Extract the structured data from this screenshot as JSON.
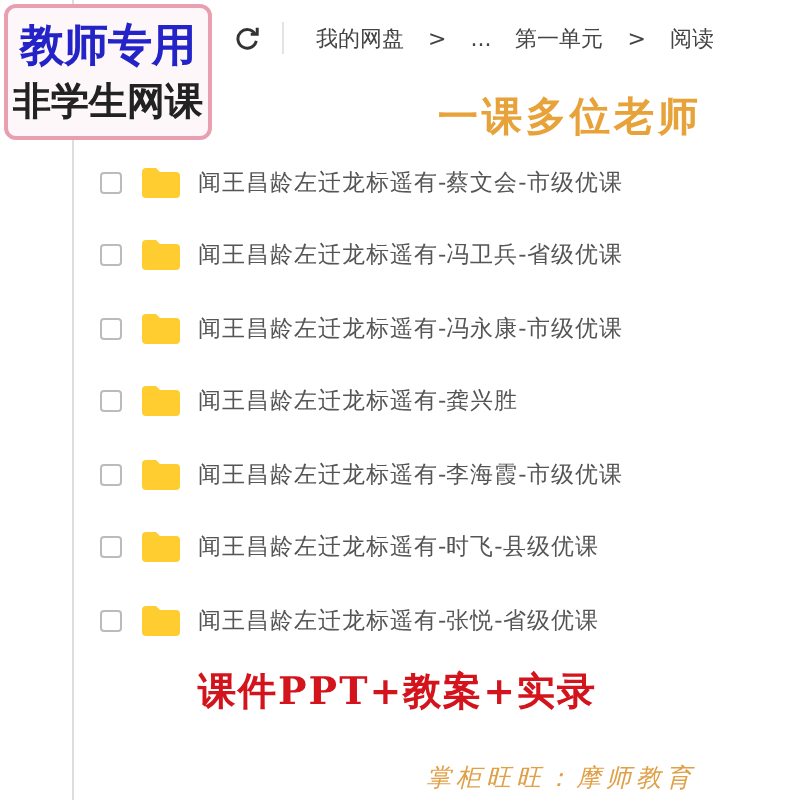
{
  "badge": {
    "line_1": "教师专用",
    "line_2": "非学生网课"
  },
  "breadcrumb": [
    "我的网盘",
    "...",
    "第一单元",
    "阅读"
  ],
  "separators": [
    ">",
    ">"
  ],
  "banner": "一课多位老师",
  "files": [
    {
      "name": "闻王昌龄左迁龙标遥有-蔡文会-市级优课",
      "checked": false
    },
    {
      "name": "闻王昌龄左迁龙标遥有-冯卫兵-省级优课",
      "checked": false
    },
    {
      "name": "闻王昌龄左迁龙标遥有-冯永康-市级优课",
      "checked": false
    },
    {
      "name": "闻王昌龄左迁龙标遥有-龚兴胜",
      "checked": false
    },
    {
      "name": "闻王昌龄左迁龙标遥有-李海霞-市级优课",
      "checked": false
    },
    {
      "name": "闻王昌龄左迁龙标遥有-时飞-县级优课",
      "checked": false
    },
    {
      "name": "闻王昌龄左迁龙标遥有-张悦-省级优课",
      "checked": false
    }
  ],
  "promo": "课件PPT+教案+实录",
  "shop": "掌柜旺旺：摩师教育"
}
